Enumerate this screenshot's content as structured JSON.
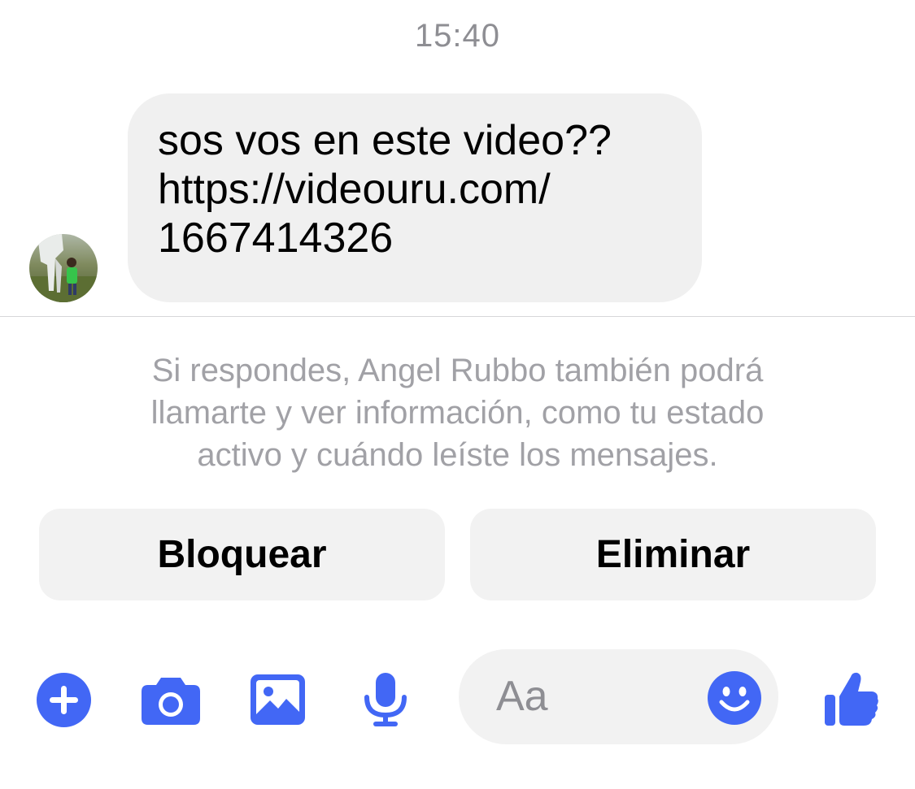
{
  "conversation": {
    "timestamp": "15:40",
    "message": {
      "lines": [
        "sos vos en este video??",
        "https://videouru.com/",
        "1667414326"
      ]
    },
    "notice": {
      "lines": [
        "Si respondes, Angel Rubbo también podrá",
        "llamarte y ver información, como tu estado",
        "activo y cuándo leíste los mensajes."
      ]
    }
  },
  "actions": {
    "block_label": "Bloquear",
    "delete_label": "Eliminar"
  },
  "composer": {
    "placeholder": "Aa"
  },
  "toolbar": {
    "icons": [
      "plus-icon",
      "camera-icon",
      "gallery-icon",
      "microphone-icon",
      "emoji-icon",
      "thumbs-up-icon"
    ]
  },
  "colors": {
    "accent": "#4267f5",
    "bubble": "#f0f0f0",
    "muted_text": "#a1a1a6"
  }
}
